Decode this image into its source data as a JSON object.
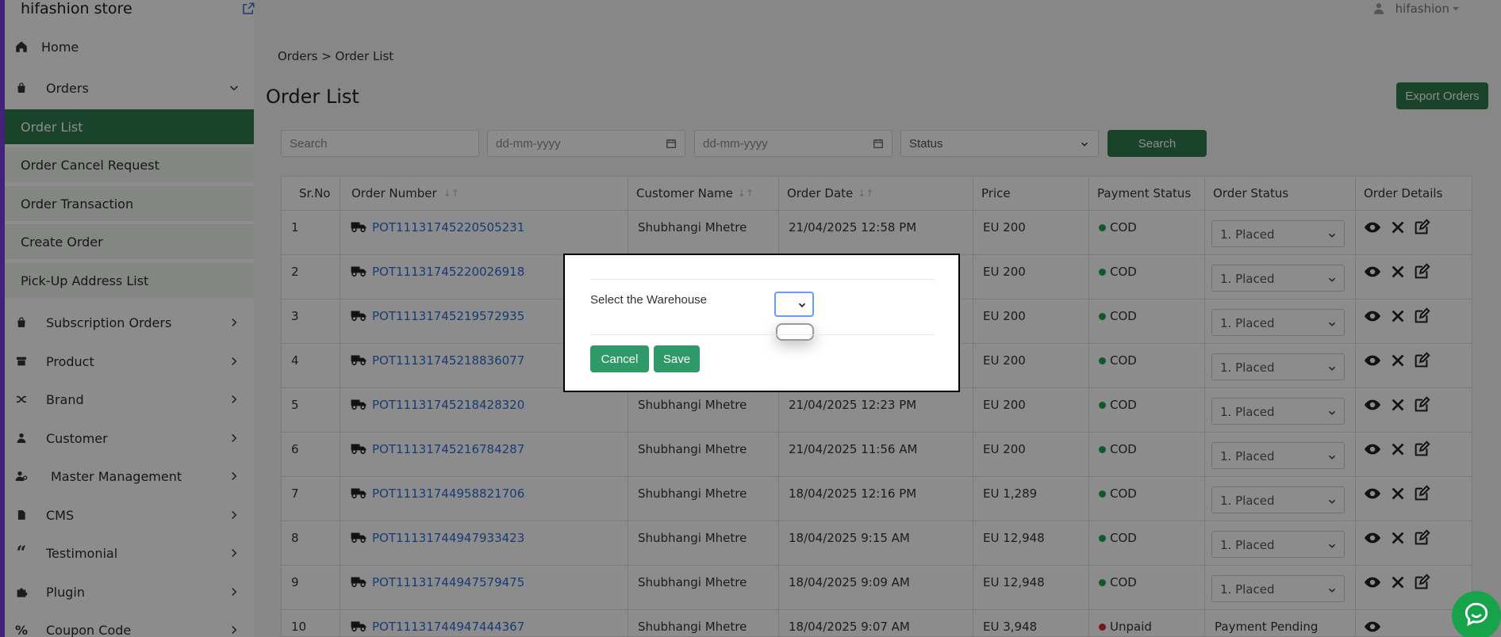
{
  "sidebar": {
    "brand": "hifashion store",
    "nav": [
      {
        "label": "Home",
        "icon": "home-icon"
      },
      {
        "label": "Orders",
        "icon": "shopping-bag-icon"
      },
      {
        "label": "Subscription Orders",
        "icon": "shopping-bag-icon"
      },
      {
        "label": "Product",
        "icon": "box-icon"
      },
      {
        "label": "Brand",
        "icon": "shuffle-icon"
      },
      {
        "label": "Customer",
        "icon": "user-icon"
      },
      {
        "label": "Master Management",
        "icon": "users-cog-icon"
      },
      {
        "label": "CMS",
        "icon": "file-icon"
      },
      {
        "label": "Testimonial",
        "icon": "quote-icon"
      },
      {
        "label": "Plugin",
        "icon": "puzzle-icon"
      },
      {
        "label": "Coupon Code",
        "icon": "percent-icon"
      }
    ],
    "orders_sub": [
      {
        "label": "Order List",
        "active": true
      },
      {
        "label": "Order Cancel Request"
      },
      {
        "label": "Order Transaction"
      },
      {
        "label": "Create Order"
      },
      {
        "label": "Pick-Up Address List"
      }
    ]
  },
  "topbar": {
    "user": "hifashion"
  },
  "breadcrumb": "Orders > Order List",
  "page_title": "Order List",
  "export_label": "Export Orders",
  "filters": {
    "search_placeholder": "Search",
    "date_from_placeholder": "dd-mm-yyyy",
    "date_to_placeholder": "dd-mm-yyyy",
    "status_placeholder": "Status",
    "search_button": "Search"
  },
  "table": {
    "headers": [
      "Sr.No",
      "Order Number",
      "Customer Name",
      "Order Date",
      "Price",
      "Payment Status",
      "Order Status",
      "Order Details"
    ],
    "rows": [
      {
        "sr": "1",
        "order": "POT11131745220505231",
        "customer": "Shubhangi Mhetre",
        "date": "21/04/2025 12:58 PM",
        "price": "EU 200",
        "payment": "COD",
        "status": "1. Placed"
      },
      {
        "sr": "2",
        "order": "POT11131745220026918",
        "customer": "",
        "date": "",
        "price": "EU 200",
        "payment": "COD",
        "status": "1. Placed"
      },
      {
        "sr": "3",
        "order": "POT11131745219572935",
        "customer": "",
        "date": "",
        "price": "EU 200",
        "payment": "COD",
        "status": "1. Placed"
      },
      {
        "sr": "4",
        "order": "POT11131745218836077",
        "customer": "",
        "date": "",
        "price": "EU 200",
        "payment": "COD",
        "status": "1. Placed"
      },
      {
        "sr": "5",
        "order": "POT11131745218428320",
        "customer": "Shubhangi Mhetre",
        "date": "21/04/2025 12:23 PM",
        "price": "EU 200",
        "payment": "COD",
        "status": "1. Placed"
      },
      {
        "sr": "6",
        "order": "POT11131745216784287",
        "customer": "Shubhangi Mhetre",
        "date": "21/04/2025 11:56 AM",
        "price": "EU 200",
        "payment": "COD",
        "status": "1. Placed"
      },
      {
        "sr": "7",
        "order": "POT11131744958821706",
        "customer": "Shubhangi Mhetre",
        "date": "18/04/2025 12:16 PM",
        "price": "EU 1,289",
        "payment": "COD",
        "status": "1. Placed"
      },
      {
        "sr": "8",
        "order": "POT11131744947933423",
        "customer": "Shubhangi Mhetre",
        "date": "18/04/2025 9:15 AM",
        "price": "EU 12,948",
        "payment": "COD",
        "status": "1. Placed"
      },
      {
        "sr": "9",
        "order": "POT11131744947579475",
        "customer": "Shubhangi Mhetre",
        "date": "18/04/2025 9:09 AM",
        "price": "EU 12,948",
        "payment": "COD",
        "status": "1. Placed"
      },
      {
        "sr": "10",
        "order": "POT11131744947444367",
        "customer": "Shubhangi Mhetre",
        "date": "18/04/2025 9:07 AM",
        "price": "EU 3,948",
        "payment": "Unpaid",
        "status": "Payment Pending"
      }
    ]
  },
  "modal": {
    "label": "Select the Warehouse",
    "cancel": "Cancel",
    "save": "Save"
  },
  "colors": {
    "accent": "#2f7d4c",
    "link": "#2a6fd6",
    "cod": "#1aa34a",
    "unpaid": "#d32f2f",
    "sidebar_border": "#7b3fe4"
  }
}
